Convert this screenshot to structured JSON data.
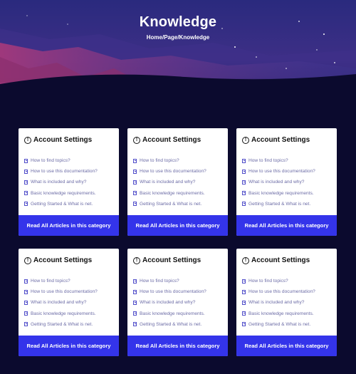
{
  "hero": {
    "title": "Knowledge",
    "breadcrumb": "Home/Page/Knowledge"
  },
  "colors": {
    "page_background": "#0b0a2e",
    "button": "#3434ea",
    "link_text": "#6c6ca6",
    "icon": "#4f4cc9"
  },
  "cards": [
    {
      "title": "Account Settings",
      "links": [
        "How to find topics?",
        "How to use this documentation?",
        "What is included and why?",
        "Basic knowledge requirements.",
        "Getting Started & What is net."
      ],
      "button": "Read All Articles in this category"
    },
    {
      "title": "Account Settings",
      "links": [
        "How to find topics?",
        "How to use this documentation?",
        "What is included and why?",
        "Basic knowledge requirements.",
        "Getting Started & What is net."
      ],
      "button": "Read All Articles in this category"
    },
    {
      "title": "Account Settings",
      "links": [
        "How to find topics?",
        "How to use this documentation?",
        "What is included and why?",
        "Basic knowledge requirements.",
        "Getting Started & What is net."
      ],
      "button": "Read All Articles in this category"
    },
    {
      "title": "Account Settings",
      "links": [
        "How to find topics?",
        "How to use this documentation?",
        "What is included and why?",
        "Basic knowledge requirements.",
        "Getting Started & What is net."
      ],
      "button": "Read All Articles in this category"
    },
    {
      "title": "Account Settings",
      "links": [
        "How to find topics?",
        "How to use this documentation?",
        "What is included and why?",
        "Basic knowledge requirements.",
        "Getting Started & What is net."
      ],
      "button": "Read All Articles in this category"
    },
    {
      "title": "Account Settings",
      "links": [
        "How to find topics?",
        "How to use this documentation?",
        "What is included and why?",
        "Basic knowledge requirements.",
        "Getting Started & What is net."
      ],
      "button": "Read All Articles in this category"
    }
  ]
}
